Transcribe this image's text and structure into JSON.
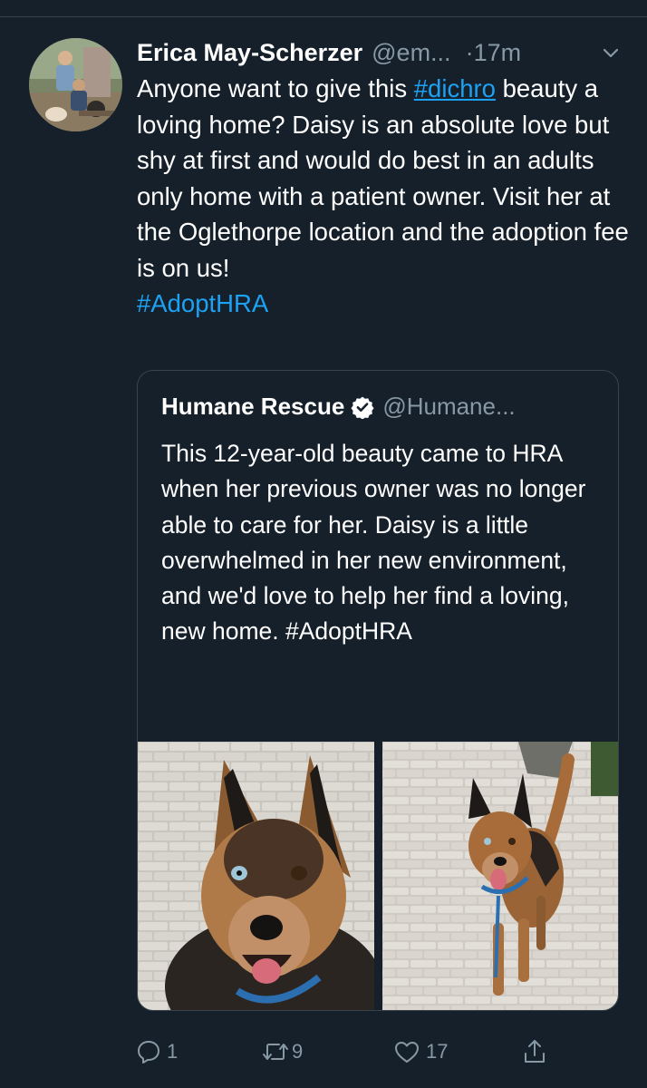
{
  "tweet": {
    "author_name": "Erica May-Scherzer",
    "author_handle": "@em...",
    "time_sep": "·",
    "time": "17m",
    "text_before": "Anyone want to give this ",
    "hashtag_1": "#dichro",
    "text_middle": " beauty a loving home? Daisy is an absolute love but shy at first and would do best in an adults only home with a patient owner. Visit her at the Oglethorpe location and the adoption fee is on us!",
    "hashtag_2": "#AdoptHRA"
  },
  "quoted": {
    "name": "Humane Rescue",
    "handle": "@Humane...",
    "text": "This 12-year-old beauty came to HRA when her previous owner was no longer able to care for her. Daisy is a little overwhelmed in her new environment, and we'd love to help her find a loving, new home. #AdoptHRA"
  },
  "actions": {
    "replies": "1",
    "retweets": "9",
    "likes": "17"
  },
  "colors": {
    "background": "#15202b",
    "link": "#1da1f2",
    "muted": "#8899a6",
    "border": "#38444d"
  },
  "icons": [
    "chevron-down-icon",
    "verified-badge-icon",
    "reply-icon",
    "retweet-icon",
    "like-icon",
    "share-icon"
  ]
}
